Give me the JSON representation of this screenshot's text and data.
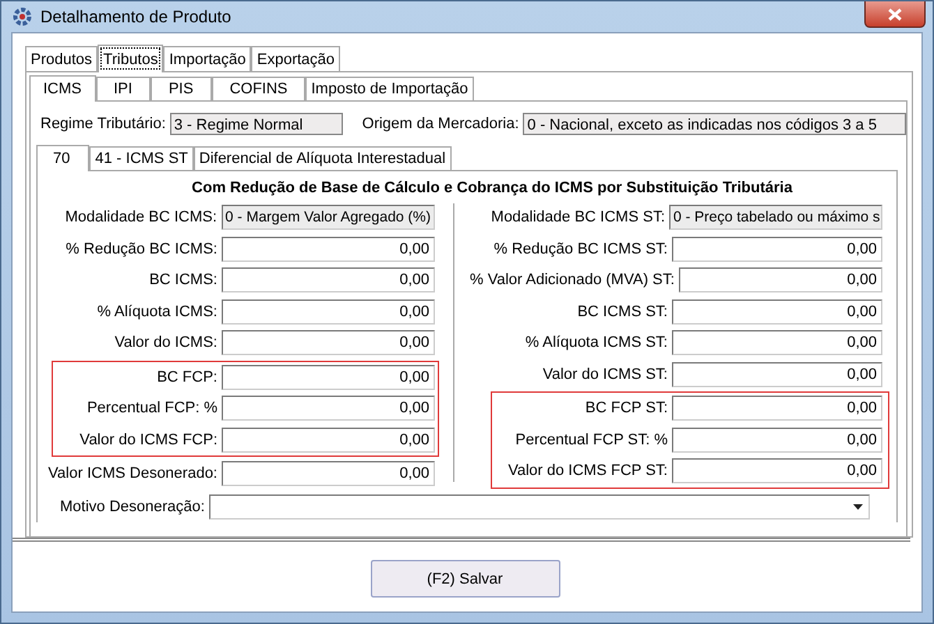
{
  "window": {
    "title": "Detalhamento de Produto"
  },
  "tabs": [
    {
      "label": "Produtos",
      "selected": false
    },
    {
      "label": "Tributos",
      "selected": true
    },
    {
      "label": "Importação",
      "selected": false
    },
    {
      "label": "Exportação",
      "selected": false
    }
  ],
  "sub_tabs": [
    {
      "label": "ICMS",
      "selected": true
    },
    {
      "label": "IPI",
      "selected": false
    },
    {
      "label": "PIS",
      "selected": false
    },
    {
      "label": "COFINS",
      "selected": false
    },
    {
      "label": "Imposto de Importação",
      "selected": false
    }
  ],
  "regime": {
    "label": "Regime Tributário:",
    "value": "3 - Regime Normal"
  },
  "origem": {
    "label": "Origem da Mercadoria:",
    "value": "0 - Nacional, exceto as indicadas nos códigos 3 a 5"
  },
  "cst_tabs": [
    {
      "label": "70",
      "selected": true
    },
    {
      "label": "41 - ICMS ST",
      "selected": false
    },
    {
      "label": "Diferencial de Alíquota Interestadual",
      "selected": false
    }
  ],
  "section_title": "Com Redução de Base de Cálculo e Cobrança do ICMS por Substituição Tributária",
  "left_fields": [
    {
      "label": "Modalidade BC ICMS:",
      "value": "0 - Margem Valor Agregado (%)",
      "kind": "choice",
      "highlighted": false
    },
    {
      "label": "% Redução BC ICMS:",
      "value": "0,00",
      "kind": "number",
      "highlighted": false
    },
    {
      "label": "BC ICMS:",
      "value": "0,00",
      "kind": "number",
      "highlighted": false
    },
    {
      "label": "% Alíquota ICMS:",
      "value": "0,00",
      "kind": "number",
      "highlighted": false
    },
    {
      "label": "Valor do ICMS:",
      "value": "0,00",
      "kind": "number",
      "highlighted": false
    },
    {
      "label": "BC FCP:",
      "value": "0,00",
      "kind": "number",
      "highlighted": true
    },
    {
      "label": "Percentual FCP: %",
      "value": "0,00",
      "kind": "number",
      "highlighted": true
    },
    {
      "label": "Valor do ICMS FCP:",
      "value": "0,00",
      "kind": "number",
      "highlighted": true
    },
    {
      "label": "Valor ICMS Desonerado:",
      "value": "0,00",
      "kind": "number",
      "highlighted": false
    }
  ],
  "right_fields": [
    {
      "label": "Modalidade BC ICMS ST:",
      "value": "0 - Preço tabelado ou máximo s",
      "kind": "choice",
      "highlighted": false
    },
    {
      "label": "% Redução BC ICMS ST:",
      "value": "0,00",
      "kind": "number",
      "highlighted": false
    },
    {
      "label": "% Valor Adicionado (MVA) ST:",
      "value": "0,00",
      "kind": "number",
      "highlighted": false
    },
    {
      "label": "BC ICMS ST:",
      "value": "0,00",
      "kind": "number",
      "highlighted": false
    },
    {
      "label": "% Alíquota ICMS ST:",
      "value": "0,00",
      "kind": "number",
      "highlighted": false
    },
    {
      "label": "Valor do ICMS ST:",
      "value": "0,00",
      "kind": "number",
      "highlighted": false
    },
    {
      "label": "BC FCP ST:",
      "value": "0,00",
      "kind": "number",
      "highlighted": true
    },
    {
      "label": "Percentual FCP ST: %",
      "value": "0,00",
      "kind": "number",
      "highlighted": true
    },
    {
      "label": "Valor do ICMS FCP ST:",
      "value": "0,00",
      "kind": "number",
      "highlighted": true
    }
  ],
  "motivo": {
    "label": "Motivo Desoneração:"
  },
  "buttons": [
    "(F2) Salvar"
  ]
}
